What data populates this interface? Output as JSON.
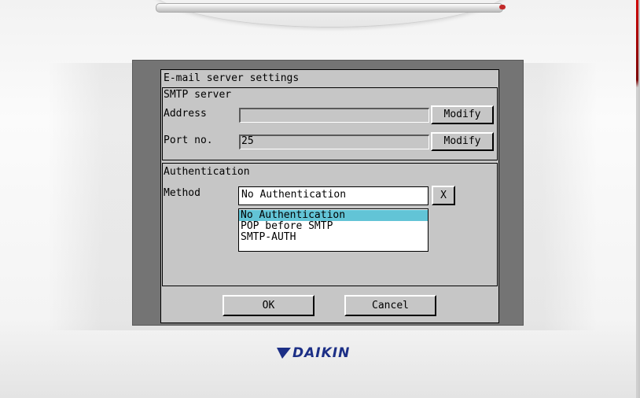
{
  "dialog": {
    "title": "E-mail server settings",
    "smtp": {
      "group_label": "SMTP server",
      "address_label": "Address",
      "address_value": "",
      "address_modify": "Modify",
      "port_label": "Port no.",
      "port_value": "25",
      "port_modify": "Modify"
    },
    "auth": {
      "group_label": "Authentication",
      "method_label": "Method",
      "method_value": "No Authentication",
      "close_label": "X",
      "options": [
        "No Authentication",
        "POP before SMTP",
        "SMTP-AUTH"
      ],
      "selected_option": "No Authentication"
    },
    "ok_label": "OK",
    "cancel_label": "Cancel"
  },
  "brand": {
    "logo_text": "DAIKIN",
    "logo_color": "#1c2f86"
  },
  "colors": {
    "selection": "#62c4d6",
    "dialog_bg": "#c6c6c6",
    "screen_bg": "#747474"
  }
}
